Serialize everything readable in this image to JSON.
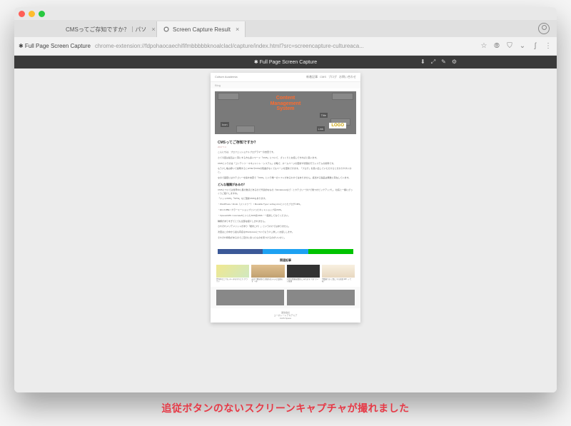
{
  "tabs": [
    {
      "title": "CMSってご存知ですか？｜パソ"
    },
    {
      "title": "Screen Capture Result"
    }
  ],
  "address": {
    "app": "✱ Full Page Screen Capture",
    "url": "chrome-extension://fdpohaocaechififmbbbbbknoalclacl/capture/index.html?src=screencapture-cultureaca..."
  },
  "capture_bar": {
    "label": "✱ Full Page Screen Capture",
    "tools": [
      "⬇",
      "⤢",
      "✎",
      "⚙"
    ]
  },
  "page": {
    "site_name": "Culture Academia",
    "nav": [
      "新着記事",
      "CMS",
      "ブログ",
      "お問い合わせ"
    ],
    "section": "Blog",
    "hero": {
      "title_l1": "Content",
      "title_l2": "Management",
      "title_l3": "System",
      "box_icon": "Icon",
      "box_title": "Title",
      "box_link": "Link",
      "logo": "LOGO"
    },
    "article": {
      "title": "CMSってご存知ですか？",
      "date": "2017.7.4",
      "p1": "こんにちは、プロフェッショナルプログラマーの吉田です。",
      "p2": "さて今回は最近よく耳にする方も多いワード「CMS」について、ざっくりとお話しできればと思います。",
      "p3": "CMSというのは「コンテンツ・マネジメント・システム」の略で、ホームページの更新や管理を行うシステムの総称です。",
      "p4": "もう少し噛み砕いて説明するとHTMLやCSSの知識がなくてもページを更新できます。「ブログ」を思い出していただけると分かりやすいかと。",
      "p5": "なので厳密にはカテゴリーを指す言葉で「CMS」という唯一のソフトがあるわけではありません。該当する製品は無数に存在しています。",
      "h2": "どんな種類があるの？",
      "p6": "CMSについては世界中に星の数ほどあるので代表的なもの（Wordpressなど）とカテゴリー分けで幾つかピックアップし、社名と一緒にざっくりご紹介しますね。",
      "p7": "「ドットCMS」「SITE」など国産CMSもあります。",
      "p8": "・WordPress / Jimdo（ジンドゥー） / Movable Type / a-blog cmsといったブログCMS。",
      "p9": "・EC-CUBE / カラーミーショップといったネットショップ系CMS。",
      "p10": "・XpressCMS / concrete5といったSNS系CMS・一度試してみてください。",
      "p11": "種類がありすぎてとても全部は紹介しきれません。",
      "p12": "されぞれメリデメリットがあり「絶対これ！」というわけではありません。",
      "p13": "次回はこの中から最も有名なWordpressについてもう少し詳しくお話しします。",
      "p14": "それぞれ特色があるのでご自分に合ったものを見つけるのがいいかと。"
    },
    "related_head": "関連記事",
    "related": [
      {
        "txt": "世界中どこでも データのやりとり クラウド"
      },
      {
        "txt": "安全で簡易的な 記録方法 テレビ会議のす ゝめ"
      },
      {
        "txt": "大切な情報を簡単 に守れます パス ワード管理"
      },
      {
        "txt": "IT関連でよく耳に する単語 API っ て何？"
      }
    ],
    "footer": {
      "operator": "運営会社",
      "company": "コーポレートアカデミア",
      "brand": "CAIS Space"
    }
  },
  "caption": "追従ボタンのないスクリーンキャプチャが撮れました"
}
